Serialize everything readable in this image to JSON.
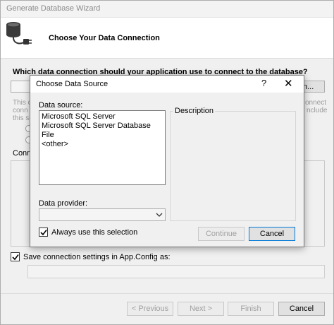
{
  "wizard": {
    "title": "Generate Database Wizard",
    "heading": "Choose Your Data Connection",
    "question": "Which data connection should your application use to connect to the database?",
    "ghost_lines": [
      "This c",
      "conn",
      "this se"
    ],
    "ghost_right": [
      "onnect",
      "nclude"
    ],
    "new_connection_partial": "n...",
    "connection_label_partial": "Conne",
    "save_label": "Save connection settings in App.Config as:",
    "save_checked": true,
    "buttons": {
      "previous": "< Previous",
      "next": "Next >",
      "finish": "Finish",
      "cancel": "Cancel"
    }
  },
  "dialog": {
    "title": "Choose Data Source",
    "help": "?",
    "close": "✕",
    "data_source_label": "Data source:",
    "data_sources": [
      "Microsoft SQL Server",
      "Microsoft SQL Server Database File",
      "<other>"
    ],
    "description_label": "Description",
    "data_provider_label": "Data provider:",
    "data_provider_value": "",
    "always_use_label": "Always use this selection",
    "always_use_checked": true,
    "continue_label": "Continue",
    "cancel_label": "Cancel"
  },
  "colors": {
    "accent": "#0078d7",
    "background": "#f0f0f0"
  }
}
